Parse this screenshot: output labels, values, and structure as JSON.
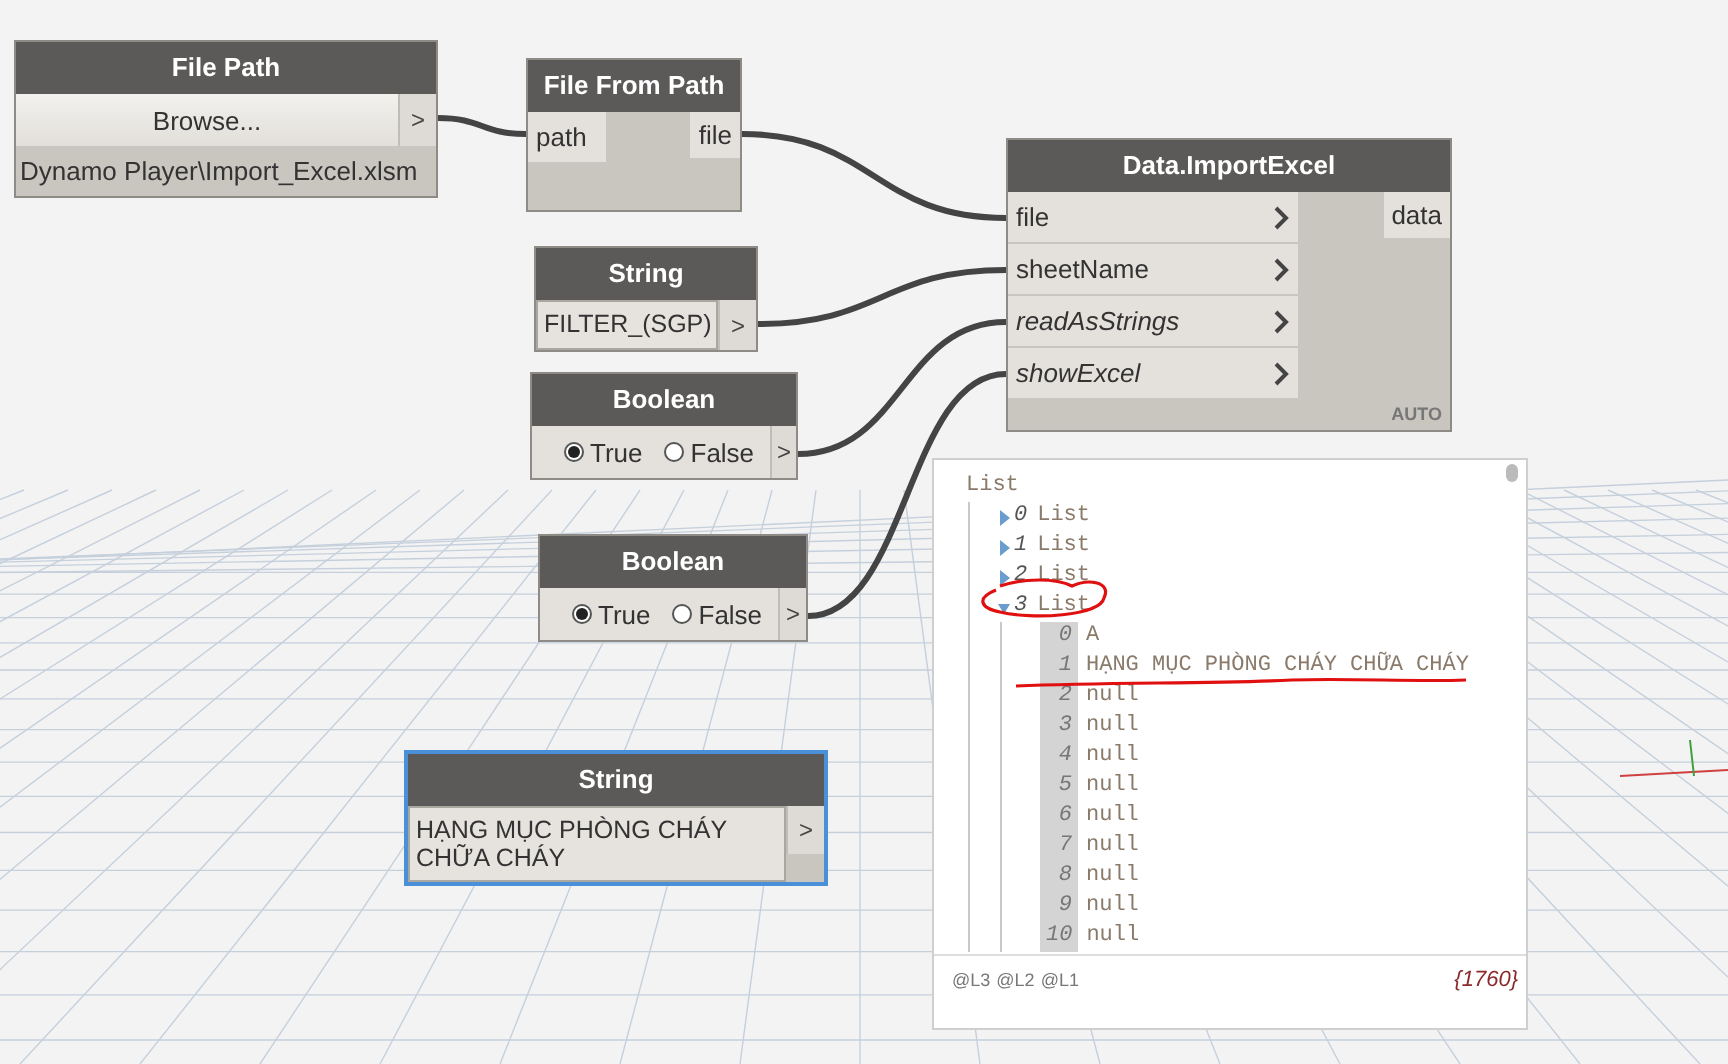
{
  "nodes": [
    {
      "kind": "file_path",
      "title": "File Path",
      "button": "Browse...",
      "port": ">",
      "path": "Dynamo Player\\Import_Excel.xlsm"
    },
    {
      "kind": "function",
      "title": "File From Path",
      "chevrons": false,
      "inputs": [
        {
          "label": "path",
          "default_value": false
        }
      ],
      "outputs": [
        "file"
      ]
    },
    {
      "kind": "function",
      "title": "Data.ImportExcel",
      "chevrons": true,
      "inputs": [
        {
          "label": "file",
          "default_value": false
        },
        {
          "label": "sheetName",
          "default_value": false
        },
        {
          "label": "readAsStrings",
          "default_value": true
        },
        {
          "label": "showExcel",
          "default_value": true
        }
      ],
      "outputs": [
        "data"
      ],
      "lacing": "AUTO"
    },
    {
      "kind": "string",
      "title": "String",
      "value": "FILTER_(SGP)",
      "port": ">",
      "selected": false
    },
    {
      "kind": "boolean",
      "title": "Boolean",
      "options": [
        {
          "label": "True",
          "selected": true
        },
        {
          "label": "False",
          "selected": false
        }
      ],
      "port": ">"
    },
    {
      "kind": "boolean",
      "title": "Boolean",
      "options": [
        {
          "label": "True",
          "selected": true
        },
        {
          "label": "False",
          "selected": false
        }
      ],
      "port": ">"
    },
    {
      "kind": "string",
      "title": "String",
      "value": "HẠNG MỤC PHÒNG CHÁY CHỮA CHÁY",
      "port": ">",
      "selected": true
    }
  ],
  "watch": {
    "root": "List",
    "items": [
      {
        "index": "0",
        "label": "List",
        "expanded": false
      },
      {
        "index": "1",
        "label": "List",
        "expanded": false
      },
      {
        "index": "2",
        "label": "List",
        "expanded": false
      },
      {
        "index": "3",
        "label": "List",
        "expanded": true,
        "children": [
          {
            "index": "0",
            "value": "A"
          },
          {
            "index": "1",
            "value": "HẠNG MỤC PHÒNG CHÁY CHỮA CHÁY"
          },
          {
            "index": "2",
            "value": "null"
          },
          {
            "index": "3",
            "value": "null"
          },
          {
            "index": "4",
            "value": "null"
          },
          {
            "index": "5",
            "value": "null"
          },
          {
            "index": "6",
            "value": "null"
          },
          {
            "index": "7",
            "value": "null"
          },
          {
            "index": "8",
            "value": "null"
          },
          {
            "index": "9",
            "value": "null"
          },
          {
            "index": "10",
            "value": "null"
          }
        ]
      }
    ],
    "levels": [
      "@L3",
      "@L2",
      "@L1"
    ],
    "count": "{1760}"
  }
}
